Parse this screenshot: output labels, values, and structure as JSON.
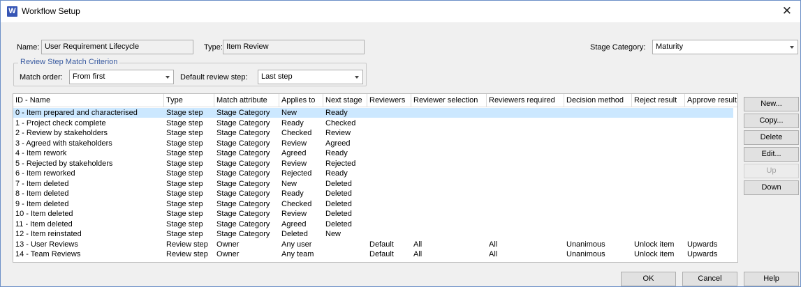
{
  "window": {
    "icon_letter": "W",
    "title": "Workflow Setup",
    "close_glyph": "✕"
  },
  "form": {
    "name_label": "Name:",
    "name_value": "User Requirement Lifecycle",
    "type_label": "Type:",
    "type_value": "Item Review",
    "stage_category_label": "Stage Category:",
    "stage_category_value": "Maturity"
  },
  "criterion": {
    "legend": "Review Step Match Criterion",
    "match_order_label": "Match order:",
    "match_order_value": "From first",
    "default_step_label": "Default review step:",
    "default_step_value": "Last step"
  },
  "grid": {
    "columns": [
      "ID - Name",
      "Type",
      "Match attribute",
      "Applies to",
      "Next stage",
      "Reviewers",
      "Reviewer selection",
      "Reviewers required",
      "Decision method",
      "Reject result",
      "Approve result"
    ],
    "selected_row": 0,
    "rows": [
      [
        "0 - Item prepared and characterised",
        "Stage step",
        "Stage Category",
        "New",
        "Ready",
        "",
        "",
        "",
        "",
        "",
        ""
      ],
      [
        "1 - Project check complete",
        "Stage step",
        "Stage Category",
        "Ready",
        "Checked",
        "",
        "",
        "",
        "",
        "",
        ""
      ],
      [
        "2 - Review by stakeholders",
        "Stage step",
        "Stage Category",
        "Checked",
        "Review",
        "",
        "",
        "",
        "",
        "",
        ""
      ],
      [
        "3 - Agreed with stakeholders",
        "Stage step",
        "Stage Category",
        "Review",
        "Agreed",
        "",
        "",
        "",
        "",
        "",
        ""
      ],
      [
        "4 - Item rework",
        "Stage step",
        "Stage Category",
        "Agreed",
        "Ready",
        "",
        "",
        "",
        "",
        "",
        ""
      ],
      [
        "5 - Rejected by stakeholders",
        "Stage step",
        "Stage Category",
        "Review",
        "Rejected",
        "",
        "",
        "",
        "",
        "",
        ""
      ],
      [
        "6 - Item reworked",
        "Stage step",
        "Stage Category",
        "Rejected",
        "Ready",
        "",
        "",
        "",
        "",
        "",
        ""
      ],
      [
        "7 - Item deleted",
        "Stage step",
        "Stage Category",
        "New",
        "Deleted",
        "",
        "",
        "",
        "",
        "",
        ""
      ],
      [
        "8 - Item deleted",
        "Stage step",
        "Stage Category",
        "Ready",
        "Deleted",
        "",
        "",
        "",
        "",
        "",
        ""
      ],
      [
        "9 - Item deleted",
        "Stage step",
        "Stage Category",
        "Checked",
        "Deleted",
        "",
        "",
        "",
        "",
        "",
        ""
      ],
      [
        "10 - Item deleted",
        "Stage step",
        "Stage Category",
        "Review",
        "Deleted",
        "",
        "",
        "",
        "",
        "",
        ""
      ],
      [
        "11 - Item deleted",
        "Stage step",
        "Stage Category",
        "Agreed",
        "Deleted",
        "",
        "",
        "",
        "",
        "",
        ""
      ],
      [
        "12 - Item reinstated",
        "Stage step",
        "Stage Category",
        "Deleted",
        "New",
        "",
        "",
        "",
        "",
        "",
        ""
      ],
      [
        "13 - User Reviews",
        "Review step",
        "Owner",
        "Any user",
        "",
        "Default",
        "All",
        "All",
        "Unanimous",
        "Unlock item",
        "Upwards"
      ],
      [
        "14 - Team Reviews",
        "Review step",
        "Owner",
        "Any team",
        "",
        "Default",
        "All",
        "All",
        "Unanimous",
        "Unlock item",
        "Upwards"
      ]
    ]
  },
  "side_buttons": [
    {
      "label": "New...",
      "enabled": true
    },
    {
      "label": "Copy...",
      "enabled": true
    },
    {
      "label": "Delete",
      "enabled": true
    },
    {
      "label": "Edit...",
      "enabled": true
    },
    {
      "label": "Up",
      "enabled": false
    },
    {
      "label": "Down",
      "enabled": true
    }
  ],
  "footer_buttons": {
    "ok": "OK",
    "cancel": "Cancel",
    "help": "Help"
  }
}
